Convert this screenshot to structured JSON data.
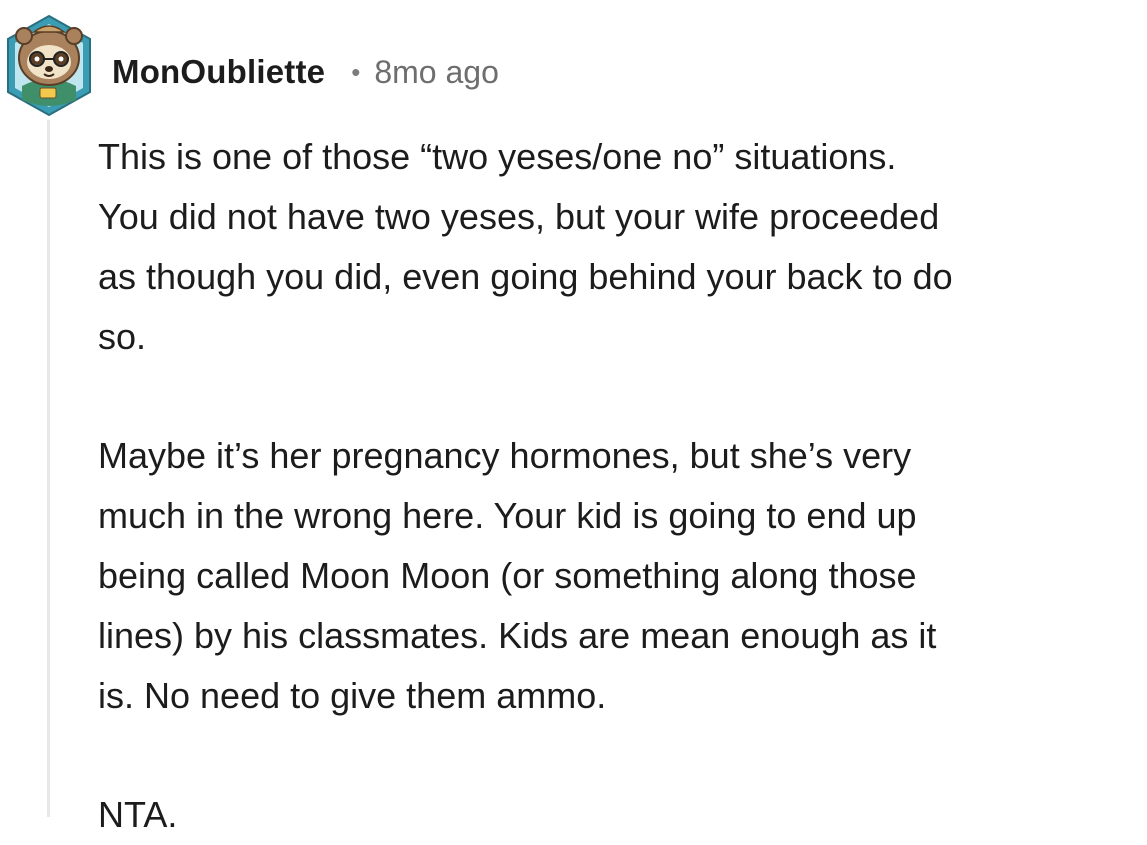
{
  "comment": {
    "author": "MonOubliette",
    "separator": "•",
    "timestamp": "8mo ago",
    "avatar": {
      "icon": "sloth-avatar-icon",
      "frame_color": "#2f8fa6",
      "fur_color": "#a9825d"
    },
    "paragraphs": [
      "This is one of those “two yeses/one no” situations.\nYou did not have two yeses, but your wife proceeded\nas though you did, even going behind your back to do\nso.",
      "Maybe it’s her pregnancy hormones, but she’s very\nmuch in the wrong here. Your kid is going to end up\nbeing called Moon Moon (or something along those\nlines) by his classmates. Kids are mean enough as it\nis. No need to give them ammo.",
      "NTA."
    ]
  }
}
